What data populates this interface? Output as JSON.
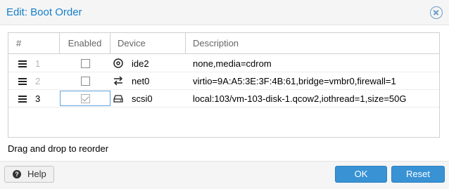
{
  "window": {
    "title": "Edit: Boot Order",
    "close_icon": "close-circle-icon"
  },
  "grid": {
    "columns": [
      "#",
      "Enabled",
      "Device",
      "Description"
    ],
    "rows": [
      {
        "order": "1",
        "enabled": false,
        "device": "ide2",
        "device_icon": "disc-icon",
        "description": "none,media=cdrom"
      },
      {
        "order": "2",
        "enabled": false,
        "device": "net0",
        "device_icon": "network-exchange-icon",
        "description": "virtio=9A:A5:3E:3F:4B:61,bridge=vmbr0,firewall=1"
      },
      {
        "order": "3",
        "enabled": true,
        "device": "scsi0",
        "device_icon": "hdd-icon",
        "description": "local:103/vm-103-disk-1.qcow2,iothread=1,size=50G"
      }
    ]
  },
  "hint": "Drag and drop to reorder",
  "buttons": {
    "help": "Help",
    "ok": "OK",
    "reset": "Reset"
  },
  "colors": {
    "title": "#157fcc",
    "primary_button": "#3892d4",
    "focus_border": "#5fa2dd"
  }
}
